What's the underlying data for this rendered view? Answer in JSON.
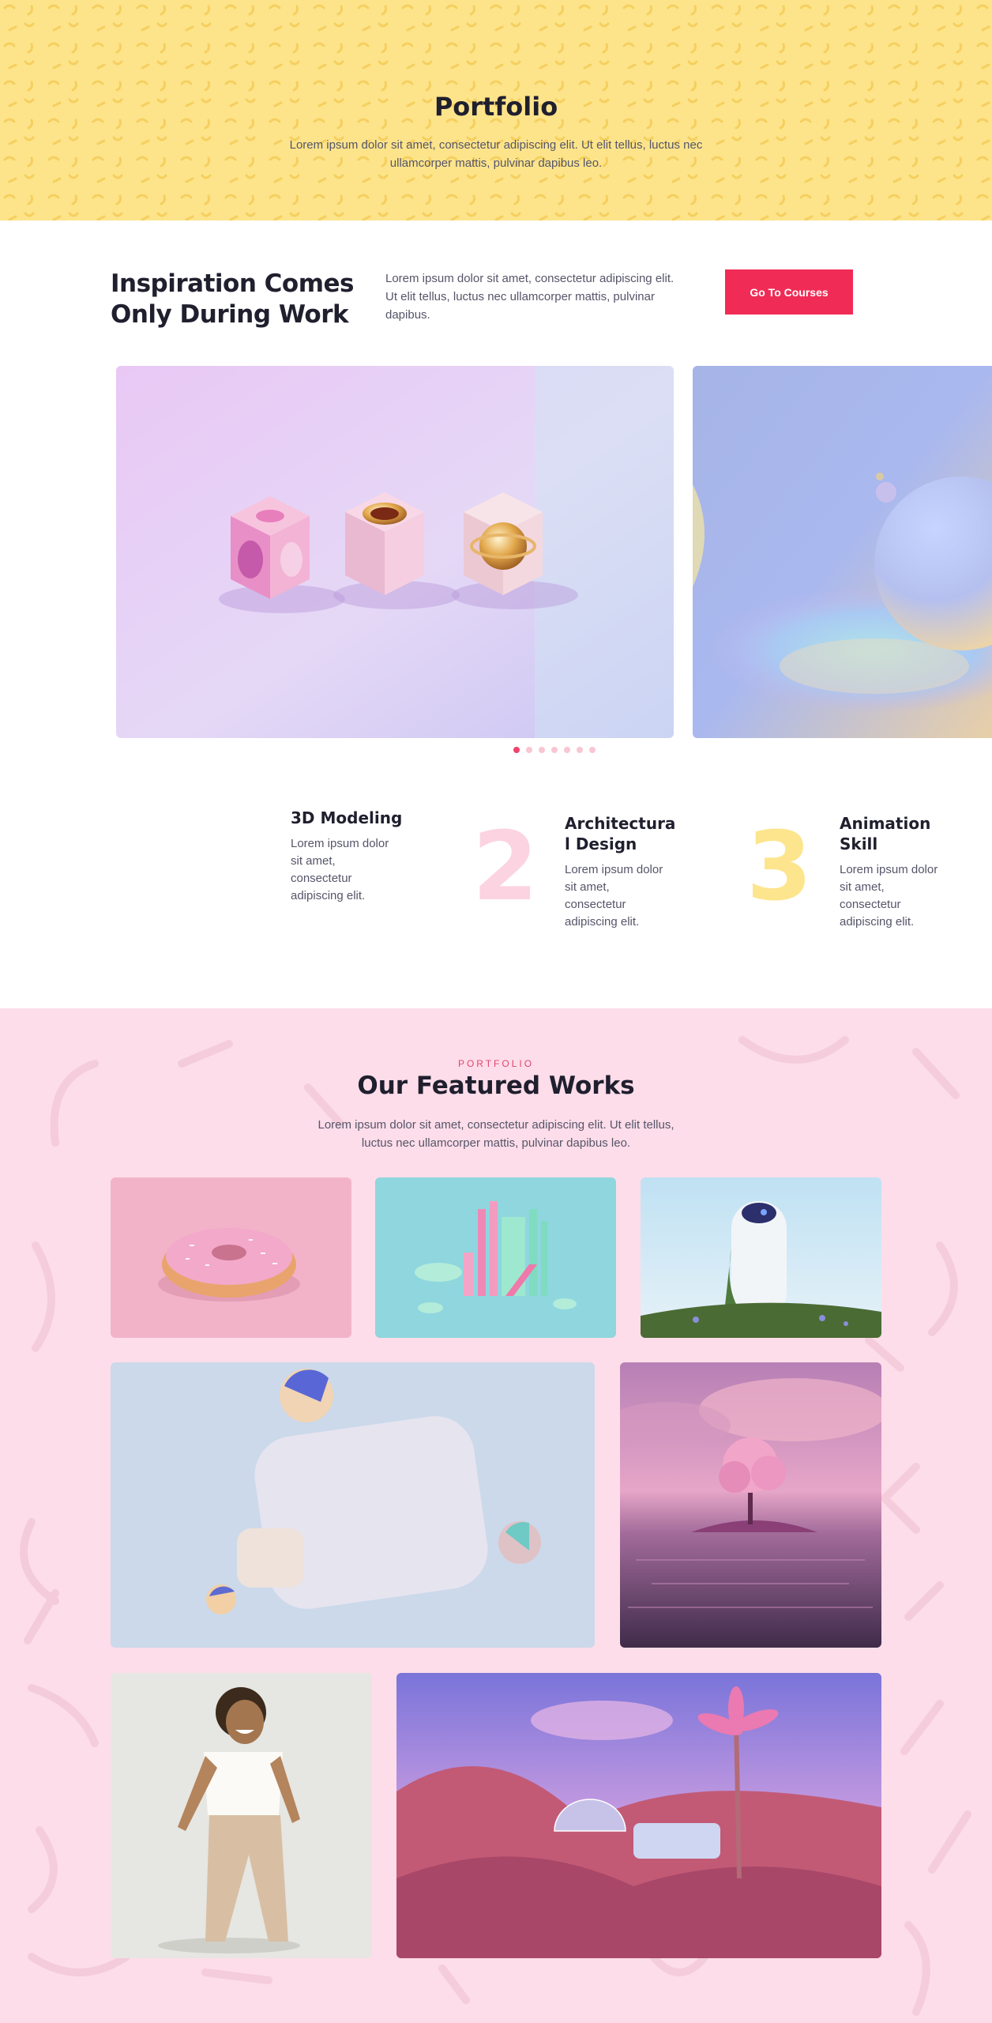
{
  "hero": {
    "title": "Portfolio",
    "description": "Lorem ipsum dolor sit amet, consectetur adipiscing elit. Ut elit tellus, luctus nec ullamcorper mattis, pulvinar dapibus leo."
  },
  "intro": {
    "heading": "Inspiration Comes Only During Work",
    "text": "Lorem ipsum dolor sit amet, consectetur adipiscing elit. Ut elit tellus, luctus nec ullamcorper mattis, pulvinar dapibus.",
    "button_label": "Go To Courses"
  },
  "slider": {
    "slide_count": 7,
    "active_index": 0
  },
  "features": [
    {
      "number": "",
      "title": "3D Modeling",
      "description": "Lorem ipsum dolor sit amet, consectetur adipiscing elit."
    },
    {
      "number": "2",
      "title": "Architectura l Design",
      "description": "Lorem ipsum dolor sit amet, consectetur adipiscing elit."
    },
    {
      "number": "3",
      "title": "Animation Skill",
      "description": "Lorem ipsum dolor sit amet, consectetur adipiscing elit."
    }
  ],
  "works": {
    "eyebrow": "PORTFOLIO",
    "title": "Our Featured Works",
    "description": "Lorem ipsum dolor sit amet, consectetur adipiscing elit. Ut elit tellus, luctus nec ullamcorper mattis, pulvinar dapibus leo."
  },
  "colors": {
    "hero_bg": "#fde48a",
    "accent": "#f02c56",
    "works_bg": "#fddde9",
    "number_pink": "#fcd3e1",
    "number_yellow": "#fde58d"
  }
}
